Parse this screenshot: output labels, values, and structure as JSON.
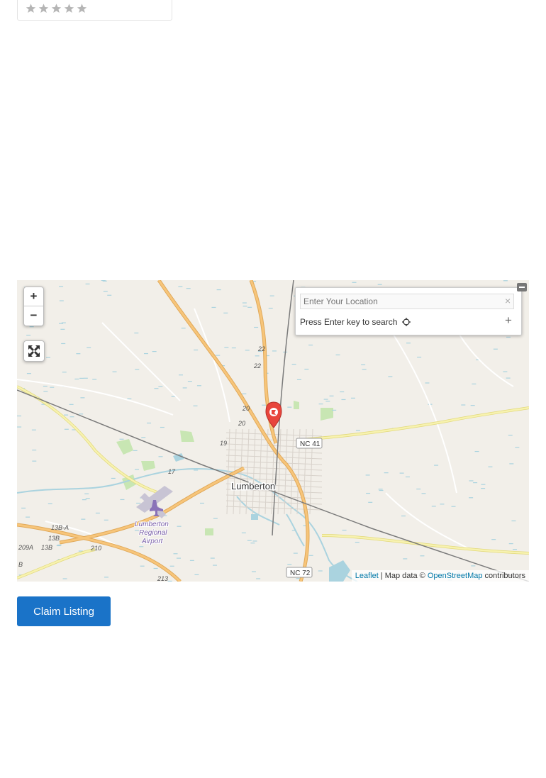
{
  "rating": {
    "stars_total": 5,
    "stars_filled": 0,
    "star_color": "#b5b5b5"
  },
  "map": {
    "zoom_in_label": "+",
    "zoom_out_label": "−",
    "search_placeholder": "Enter Your Location",
    "clear_label": "×",
    "hint": "Press Enter key to search",
    "add_label": "+",
    "collapse_label": "−",
    "attribution": {
      "leaflet": "Leaflet",
      "sep": " | Map data © ",
      "osm": "OpenStreetMap",
      "suffix": " contributors"
    },
    "labels": {
      "city": "Lumberton",
      "airport_line1": "Lumberton",
      "airport_line2": "Regional",
      "airport_line3": "Airport"
    },
    "road_shields": [
      "NC 41",
      "NC 72"
    ],
    "road_numbers": [
      "22",
      "22",
      "20",
      "20",
      "19",
      "17",
      "13B-A",
      "13B",
      "209A",
      "13B",
      "210",
      "213",
      "B"
    ],
    "colors": {
      "land": "#f2efe9",
      "major_road": "#f7c57a",
      "secondary_road": "#f5f0a8",
      "water": "#aad3df",
      "park": "#c8e6b3",
      "marker": "#e8453c"
    }
  },
  "actions": {
    "claim_label": "Claim Listing"
  }
}
